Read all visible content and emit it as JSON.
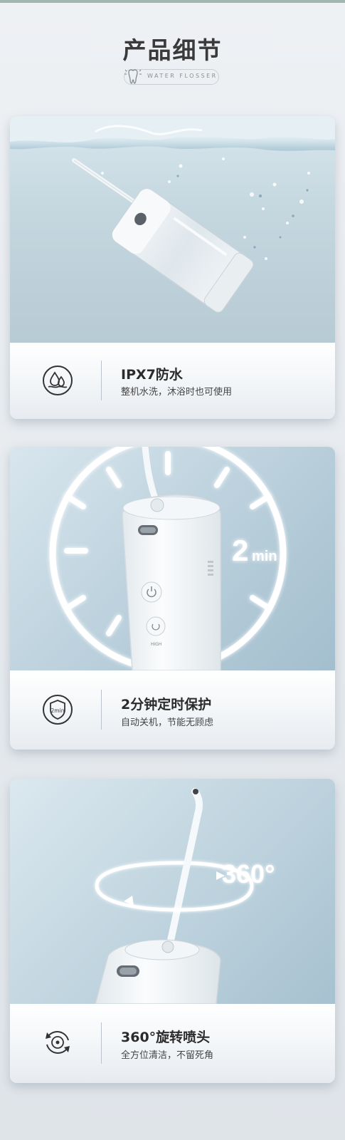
{
  "header": {
    "title": "产品细节",
    "subtitle": "WATER FLOSSER"
  },
  "features": [
    {
      "title": "IPX7防水",
      "description": "整机水洗，沐浴时也可使用",
      "icon": "water-drops-icon"
    },
    {
      "title": "2分钟定时保护",
      "description": "自动关机，节能无顾虑",
      "icon": "timer-shield-icon",
      "badge": "2min",
      "overlay_value": "2",
      "overlay_unit": "min",
      "device_label": "HIGH"
    },
    {
      "title": "360°旋转喷头",
      "description": "全方位清洁，不留死角",
      "icon": "rotate-icon",
      "overlay": "360°"
    }
  ],
  "colors": {
    "accent_top": "#9fb7ae",
    "card_sky": "#c4d6df",
    "text_dark": "#2b2b2b"
  }
}
